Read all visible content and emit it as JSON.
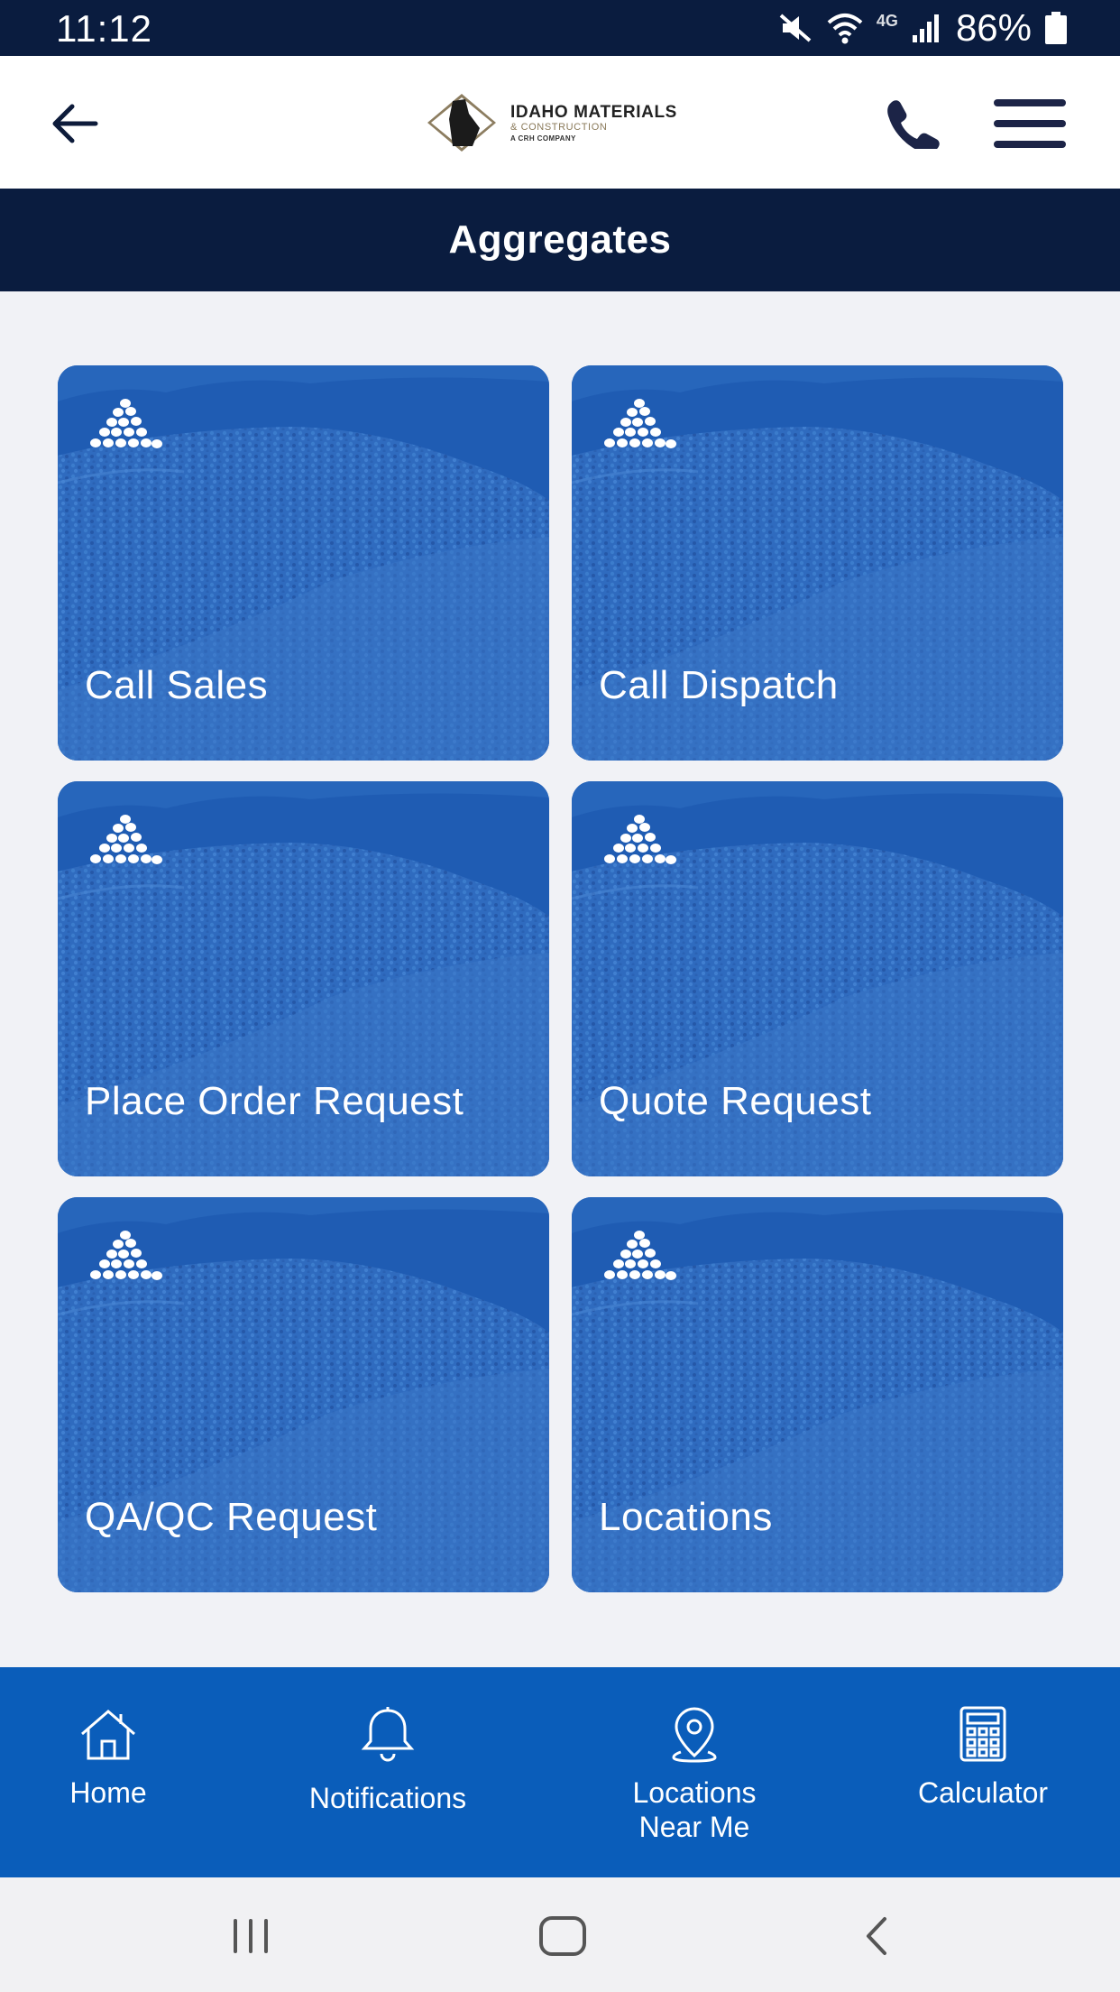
{
  "status_bar": {
    "time": "11:12",
    "network": "4G",
    "battery": "86%"
  },
  "header": {
    "logo": {
      "mark": "IMC",
      "name": "IDAHO MATERIALS",
      "subtitle": "& CONSTRUCTION",
      "tagline": "A CRH COMPANY"
    },
    "back_icon": "arrow-left-icon",
    "phone_icon": "phone-icon",
    "menu_icon": "hamburger-menu-icon"
  },
  "page": {
    "title": "Aggregates"
  },
  "tiles": [
    {
      "label": "Call Sales"
    },
    {
      "label": "Call Dispatch"
    },
    {
      "label": "Place Order Request"
    },
    {
      "label": "Quote Request"
    },
    {
      "label": "QA/QC Request"
    },
    {
      "label": "Locations"
    }
  ],
  "bottom_nav": [
    {
      "label": "Home",
      "icon": "home-icon"
    },
    {
      "label": "Notifications",
      "icon": "bell-icon"
    },
    {
      "label": "Locations Near Me",
      "icon": "location-pin-icon"
    },
    {
      "label": "Calculator",
      "icon": "calculator-icon"
    }
  ],
  "colors": {
    "navy": "#0a1c3f",
    "tile_blue": "#2a66ba",
    "nav_blue": "#0a5dba",
    "background": "#f1f2f6"
  }
}
